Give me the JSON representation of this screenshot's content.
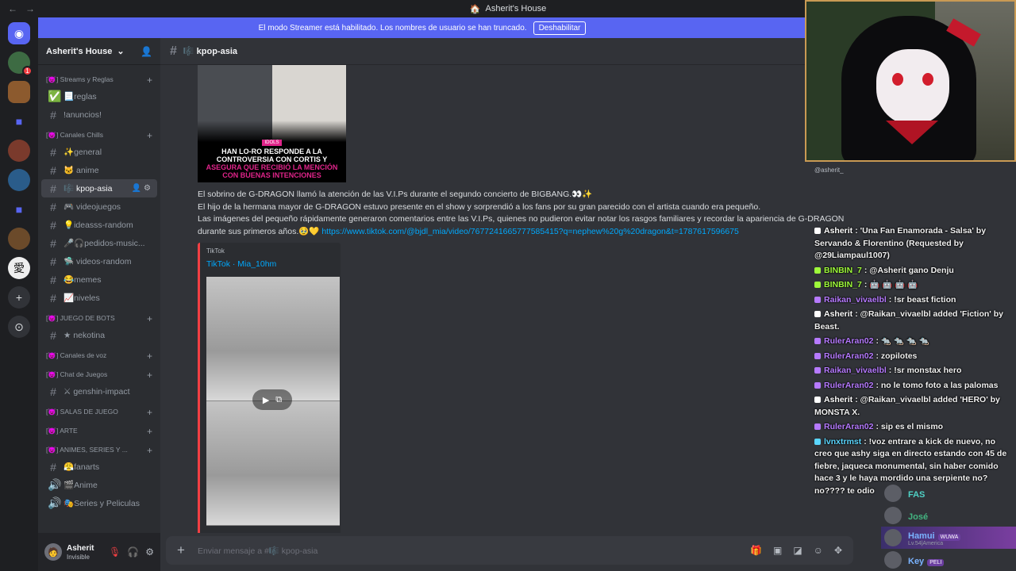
{
  "window": {
    "title": "Asherit's House",
    "nav_back": "←",
    "nav_fwd": "→",
    "title_icon": "house-icon"
  },
  "banner": {
    "text": "El modo Streamer está habilitado. Los nombres de usuario se han truncado.",
    "button": "Deshabilitar",
    "color": "#5865f2"
  },
  "server": {
    "name": "Asherit's House"
  },
  "sidebar": {
    "categories": [
      {
        "label": "[😈] Streams y Reglas",
        "channels": [
          {
            "icon": "✅",
            "label": "📃reglas"
          },
          {
            "icon": "#",
            "label": "!anuncios!"
          }
        ]
      },
      {
        "label": "[😈] Canales Chills",
        "channels": [
          {
            "icon": "#",
            "label": "✨general"
          },
          {
            "icon": "#",
            "label": "🐱 anime"
          },
          {
            "icon": "#",
            "label": "🎼 kpop-asia",
            "active": true
          },
          {
            "icon": "#",
            "label": "🎮 videojuegos"
          },
          {
            "icon": "#",
            "label": "💡ideasss-random"
          },
          {
            "icon": "#",
            "label": "🎤🎧pedidos-music..."
          },
          {
            "icon": "#",
            "label": "🛸 videos-random"
          },
          {
            "icon": "#",
            "label": "😂memes"
          },
          {
            "icon": "#",
            "label": "📈niveles"
          }
        ]
      },
      {
        "label": "[😈] JUEGO DE BOTS",
        "channels": [
          {
            "icon": "#",
            "label": "★ nekotina"
          }
        ]
      },
      {
        "label": "[😈] Canales de voz",
        "channels": []
      },
      {
        "label": "[😈] Chat de Juegos",
        "channels": [
          {
            "icon": "#",
            "label": "⚔ genshin-impact"
          }
        ]
      },
      {
        "label": "[😈] SALAS DE JUEGO",
        "channels": []
      },
      {
        "label": "[😈] ARTE",
        "channels": []
      },
      {
        "label": "[😈] ANIMES, SERIES Y ...",
        "channels": [
          {
            "icon": "#",
            "label": "😤fanarts"
          },
          {
            "icon": "🔊",
            "label": "🎬Anime"
          },
          {
            "icon": "🔊",
            "label": "🎭Series y Peliculas"
          }
        ]
      }
    ]
  },
  "user": {
    "name": "Asherit",
    "status": "Invisible"
  },
  "channel": {
    "name": "🎼 kpop-asia"
  },
  "post": {
    "image": {
      "tag": "IDOLS",
      "line1": "HAN LO-RO RESPONDE A LA CONTROVERSIA CON CORTIS Y",
      "line2": "ASEGURA QUE RECIBIÓ LA MENCIÓN CON BUENAS INTENCIONES"
    },
    "text1": "El sobrino de G-DRAGON llamó la atención de las V.I.Ps durante el segundo concierto de BIGBANG.👀✨",
    "text2": "El hijo de la hermana mayor de G-DRAGON estuvo presente en el show y sorprendió a los fans por su gran parecido con el artista cuando era pequeño.",
    "text3": "Las imágenes del pequeño rápidamente generaron comentarios entre las V.I.Ps, quienes no pudieron evitar notar los rasgos familiares y recordar la apariencia de G-DRAGON durante sus primeros años.🥹💛",
    "link": "https://www.tiktok.com/@bjdl_mia/video/7677241665777585415?q=nephew%20g%20dragon&t=1787617596675",
    "embed": {
      "provider": "TikTok",
      "title": "TikTok · Mia_10hm"
    }
  },
  "composer": {
    "placeholder": "Enviar mensaje a #🎼 kpop-asia"
  },
  "overlay": {
    "cam_label": "@asherit_",
    "chat": [
      {
        "user": "Asherit",
        "color": "#ffffff",
        "text": ": 'Una Fan Enamorada - Salsa' by Servando & Florentino (Requested by @29Liampaul1007)"
      },
      {
        "user": "BINBIN_7",
        "color": "#9efa3a",
        "text": ": @Asherit gano Denju"
      },
      {
        "user": "BINBIN_7",
        "color": "#9efa3a",
        "text": ": 🤖 🤖 🤖 🤖"
      },
      {
        "user": "Raikan_vivaelbl",
        "color": "#b67aff",
        "text": ": !sr beast fiction"
      },
      {
        "user": "Asherit",
        "color": "#ffffff",
        "text": ": @Raikan_vivaelbl added 'Fiction' by Beast."
      },
      {
        "user": "RulerAran02",
        "color": "#b67aff",
        "text": ": 🐀 🐀 🐀 🐀"
      },
      {
        "user": "RulerAran02",
        "color": "#b67aff",
        "text": ": zopilotes"
      },
      {
        "user": "Raikan_vivaelbl",
        "color": "#b67aff",
        "text": ": !sr monstax hero"
      },
      {
        "user": "RulerAran02",
        "color": "#b67aff",
        "text": ": no le tomo foto a las palomas"
      },
      {
        "user": "Asherit",
        "color": "#ffffff",
        "text": ": @Raikan_vivaelbl added 'HERO' by MONSTA X."
      },
      {
        "user": "RulerAran02",
        "color": "#b67aff",
        "text": ": sip es el mismo"
      },
      {
        "user": "lvnxtrmst",
        "color": "#5ad6ff",
        "text": ": !voz entrare a kick de nuevo, no creo que ashy siga en directo estando con 45 de fiebre, jaqueca monumental, sin haber comido hace 3 y le haya mordido una serpiente no? no???? te odio"
      }
    ],
    "members": [
      {
        "name": "FAS",
        "color": "#4fd1c5",
        "sub": ""
      },
      {
        "name": "José",
        "color": "#43b581",
        "sub": ""
      },
      {
        "name": "Hamui",
        "color": "#7ab3ff",
        "sub": "Lv.54|America",
        "tag": "WUWA"
      },
      {
        "name": "Key",
        "color": "#7ab3ff",
        "sub": "",
        "tag": "PELI"
      }
    ]
  }
}
